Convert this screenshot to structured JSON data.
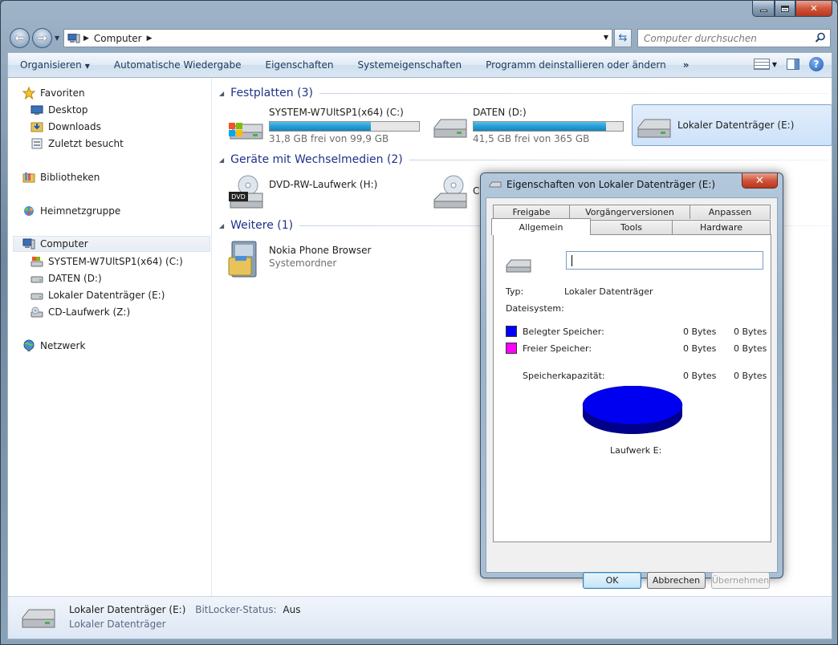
{
  "address": {
    "crumb": "Computer",
    "search_placeholder": "Computer durchsuchen"
  },
  "toolbar": {
    "items": [
      "Organisieren",
      "Automatische Wiedergabe",
      "Eigenschaften",
      "Systemeigenschaften",
      "Programm deinstallieren oder ändern"
    ],
    "more": "»"
  },
  "sidebar": {
    "favorites": {
      "title": "Favoriten",
      "items": [
        "Desktop",
        "Downloads",
        "Zuletzt besucht"
      ]
    },
    "libraries": "Bibliotheken",
    "homegroup": "Heimnetzgruppe",
    "computer": {
      "title": "Computer",
      "items": [
        "SYSTEM-W7UltSP1(x64) (C:)",
        "DATEN (D:)",
        "Lokaler Datenträger (E:)",
        "CD-Laufwerk (Z:)"
      ]
    },
    "network": "Netzwerk"
  },
  "content": {
    "groups": [
      {
        "title": "Festplatten (3)"
      },
      {
        "title": "Geräte mit Wechselmedien (2)"
      },
      {
        "title": "Weitere (1)"
      }
    ],
    "drives": [
      {
        "name": "SYSTEM-W7UltSP1(x64) (C:)",
        "sub": "31,8 GB frei von 99,9 GB",
        "used_fraction": 0.68
      },
      {
        "name": "DATEN (D:)",
        "sub": "41,5 GB frei von 365 GB",
        "used_fraction": 0.886
      },
      {
        "name": "Lokaler Datenträger (E:)"
      }
    ],
    "removable": [
      {
        "name": "DVD-RW-Laufwerk (H:)",
        "badge": "DVD"
      },
      {
        "name": "C"
      }
    ],
    "other": [
      {
        "name": "Nokia Phone Browser",
        "sub": "Systemordner"
      }
    ]
  },
  "status": {
    "name": "Lokaler Datenträger (E:)",
    "bitlocker_label": "BitLocker-Status:",
    "bitlocker_value": "Aus",
    "type": "Lokaler Datenträger"
  },
  "dialog": {
    "title": "Eigenschaften von Lokaler Datenträger (E:)",
    "tabs_row1": [
      "Freigabe",
      "Vorgängerversionen",
      "Anpassen"
    ],
    "tabs_row2": [
      "Allgemein",
      "Tools",
      "Hardware"
    ],
    "type_label": "Typ:",
    "type_value": "Lokaler Datenträger",
    "fs_label": "Dateisystem:",
    "used_label": "Belegter Speicher:",
    "used_bytes": "0 Bytes",
    "used_bytes2": "0 Bytes",
    "free_label": "Freier Speicher:",
    "free_bytes": "0 Bytes",
    "free_bytes2": "0 Bytes",
    "cap_label": "Speicherkapazität:",
    "cap_bytes": "0 Bytes",
    "cap_bytes2": "0 Bytes",
    "drive_label": "Laufwerk E:",
    "ok": "OK",
    "cancel": "Abbrechen",
    "apply": "Übernehmen",
    "colors": {
      "used": "#0000ff",
      "free": "#ff00ff"
    }
  }
}
